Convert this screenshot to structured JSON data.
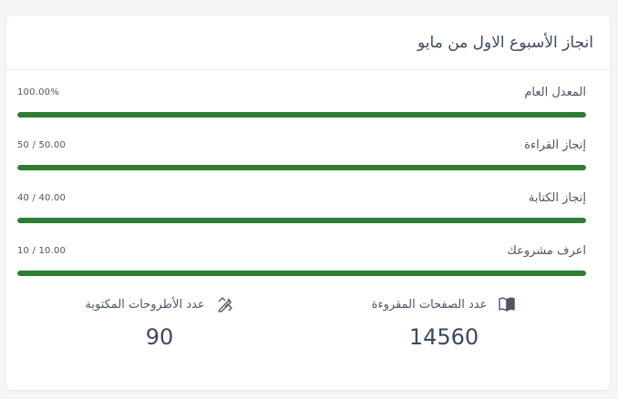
{
  "card": {
    "title": "انجاز الأسبوع الاول من مايو"
  },
  "metrics": [
    {
      "label": "المعدل العام",
      "value": "100.00%",
      "progress": 1.0
    },
    {
      "label": "إنجاز القراءة",
      "value": "50 / 50.00",
      "progress": 1.0
    },
    {
      "label": "إنجاز الكتابة",
      "value": "40 / 40.00",
      "progress": 1.0
    },
    {
      "label": "اعرف مشروعك",
      "value": "10 / 10.00",
      "progress": 1.0
    }
  ],
  "stats": {
    "pages": {
      "label": "عدد الصفحات المقروءة",
      "value": "14560",
      "icon": "open-book-icon"
    },
    "theses": {
      "label": "عدد الأطروحات المكتوبة",
      "value": "90",
      "icon": "pencil-ruler-icon"
    }
  },
  "colors": {
    "progress_fill": "#2e7d32",
    "track": "#e9ecef",
    "text": "#4c5666"
  }
}
